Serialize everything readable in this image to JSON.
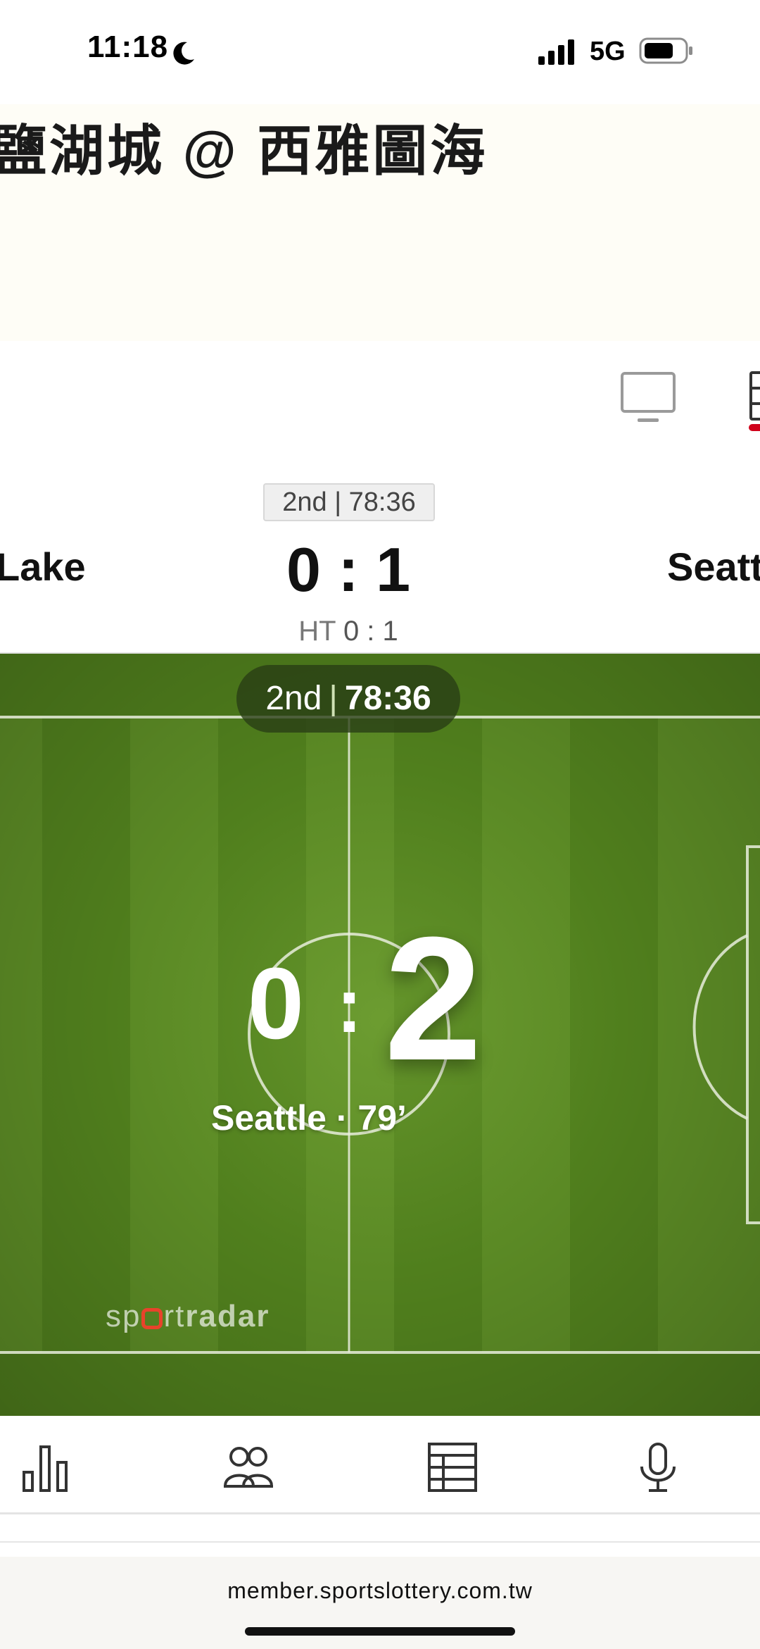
{
  "status_bar": {
    "time": "11:18",
    "network": "5G",
    "icons": [
      "moon-icon",
      "cellular-signal-icon",
      "battery-icon"
    ]
  },
  "header": {
    "match_title": "鹽湖城 @ 西雅圖海"
  },
  "toolbar": {
    "icons": [
      "tv-icon",
      "stats-tab-icon"
    ],
    "active_color": "#d0021b"
  },
  "scoreboard": {
    "period": "2nd | 78:36",
    "home_team": "Lake",
    "away_team": "Seatt",
    "score": "0 : 1",
    "ht_label": "HT",
    "ht_score": "0 : 1"
  },
  "pitch": {
    "period": "2nd",
    "clock": "78:36",
    "goal_home": "0",
    "goal_colon": ":",
    "goal_away": "2",
    "goal_info": "Seattle · 79’",
    "logo_prefix": "sp",
    "logo_mid": "rt",
    "logo_bold": "radar",
    "colors": {
      "grass": "#5c8a25",
      "line": "#e8eddc"
    }
  },
  "widget_tabs": {
    "icons": [
      "bar-chart-icon",
      "lineups-icon",
      "standings-table-icon",
      "microphone-icon"
    ]
  },
  "browser": {
    "url": "member.sportslottery.com.tw"
  }
}
